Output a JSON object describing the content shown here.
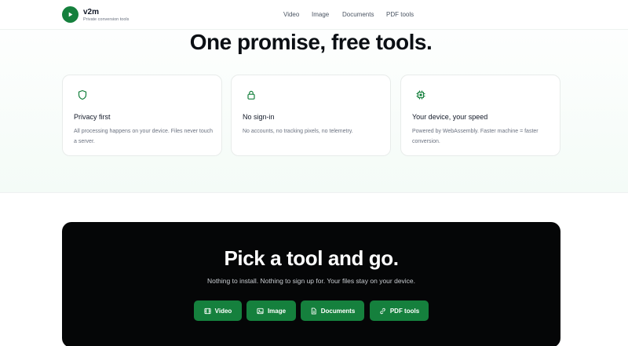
{
  "brand": {
    "name": "v2m",
    "tagline": "Private conversion tools",
    "accent_color": "#15803d",
    "logo_icon": "play-icon"
  },
  "nav": {
    "items": [
      {
        "label": "Video"
      },
      {
        "label": "Image"
      },
      {
        "label": "Documents"
      },
      {
        "label": "PDF tools"
      }
    ]
  },
  "hero": {
    "title": "One promise, free tools."
  },
  "features": [
    {
      "icon": "shield-icon",
      "title": "Privacy first",
      "description": "All processing happens on your device. Files never touch a server."
    },
    {
      "icon": "lock-icon",
      "title": "No sign-in",
      "description": "No accounts, no tracking pixels, no telemetry."
    },
    {
      "icon": "chip-icon",
      "title": "Your device, your speed",
      "description": "Powered by WebAssembly. Faster machine = faster conversion."
    }
  ],
  "cta": {
    "title": "Pick a tool and go.",
    "subtitle": "Nothing to install. Nothing to sign up for. Your files stay on your device.",
    "buttons": [
      {
        "label": "Video",
        "icon": "film-icon"
      },
      {
        "label": "Image",
        "icon": "image-icon"
      },
      {
        "label": "Documents",
        "icon": "document-icon"
      },
      {
        "label": "PDF tools",
        "icon": "link-icon"
      }
    ]
  }
}
